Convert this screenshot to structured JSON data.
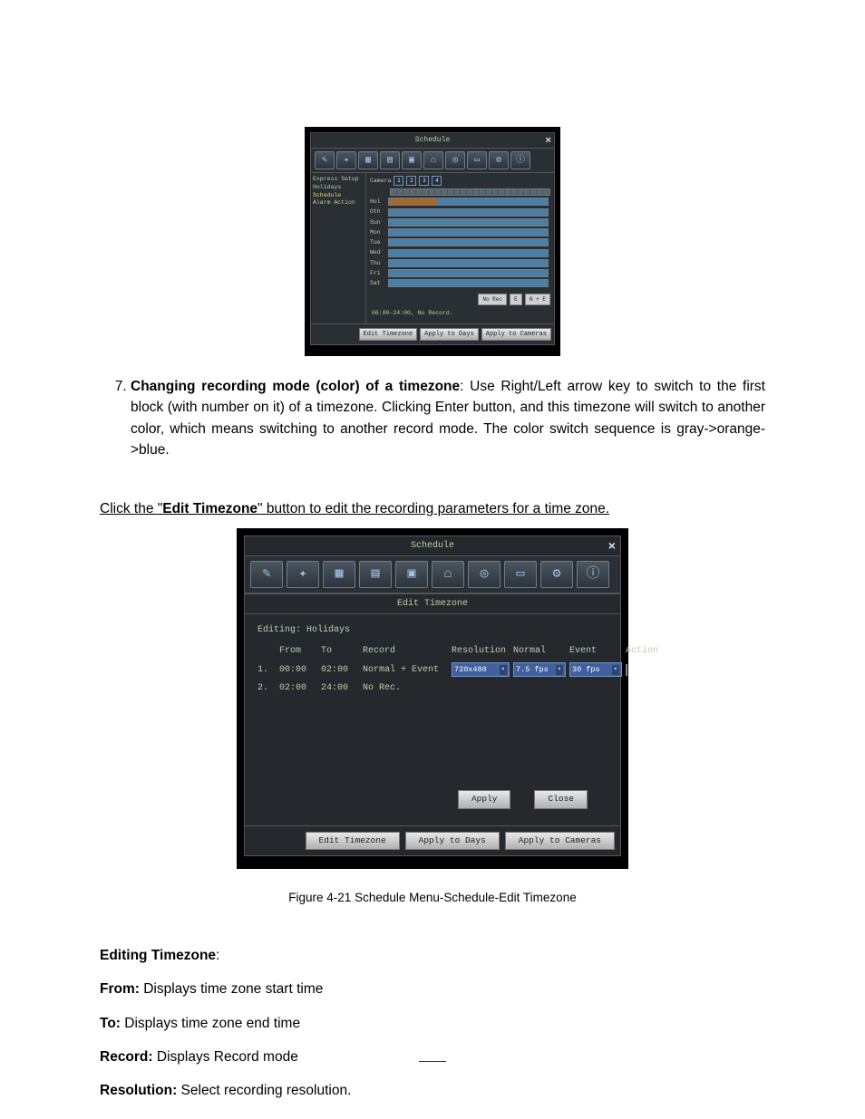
{
  "list_item_number": 7,
  "para7": {
    "bold": "Changing recording mode (color) of a timezone",
    "rest": ": Use Right/Left arrow key to switch to the first block (with number on it) of a timezone. Clicking Enter button, and this timezone will switch to another color, which means switching to another record mode. The color switch sequence is gray->orange->blue."
  },
  "click_line": {
    "pre": "Click the \"",
    "bold": "Edit Timezone",
    "post": "\" button to edit the recording parameters for a time zone."
  },
  "shot1": {
    "title": "Schedule",
    "side": [
      "Express Setup",
      "Holidays",
      "Schedule",
      "Alarm Action"
    ],
    "side_selected_index": 2,
    "camera_label": "Camera",
    "cameras": [
      "1",
      "2",
      "3",
      "4"
    ],
    "days": [
      "Hol",
      "Oth",
      "Sun",
      "Mon",
      "Tue",
      "Wed",
      "Thu",
      "Fri",
      "Sat"
    ],
    "legend": {
      "norec": "No Rec",
      "e": "E",
      "ne": "N + E"
    },
    "status": "06:00-24:00, No Record.",
    "buttons": [
      "Edit Timezone",
      "Apply to Days",
      "Apply to Cameras"
    ]
  },
  "shot2": {
    "title": "Schedule",
    "subtitle": "Edit Timezone",
    "editing": "Editing: Holidays",
    "cols": [
      "",
      "From",
      "To",
      "Record",
      "Resolution",
      "Normal",
      "Event",
      "Action"
    ],
    "rows": [
      {
        "n": "1.",
        "from": "00:00",
        "to": "02:00",
        "rec": "Normal + Event",
        "res": "720x480",
        "normal": "7.5 fps",
        "event": "30 fps",
        "action": true
      },
      {
        "n": "2.",
        "from": "02:00",
        "to": "24:00",
        "rec": "No Rec.",
        "res": "",
        "normal": "",
        "event": "",
        "action": false
      }
    ],
    "apply": "Apply",
    "close": "Close",
    "buttons": [
      "Edit Timezone",
      "Apply to Days",
      "Apply to Cameras"
    ]
  },
  "fig_caption": "Figure 4-21 Schedule Menu-Schedule-Edit Timezone",
  "defs": {
    "heading": "Editing Timezone",
    "from_l": "From:",
    "from_t": " Displays time zone start time",
    "to_l": "To:",
    "to_t": " Displays time zone end time",
    "rec_l": "Record:",
    "rec_t": " Displays Record mode",
    "res_l": "Resolution:",
    "res_t": " Select recording resolution."
  }
}
